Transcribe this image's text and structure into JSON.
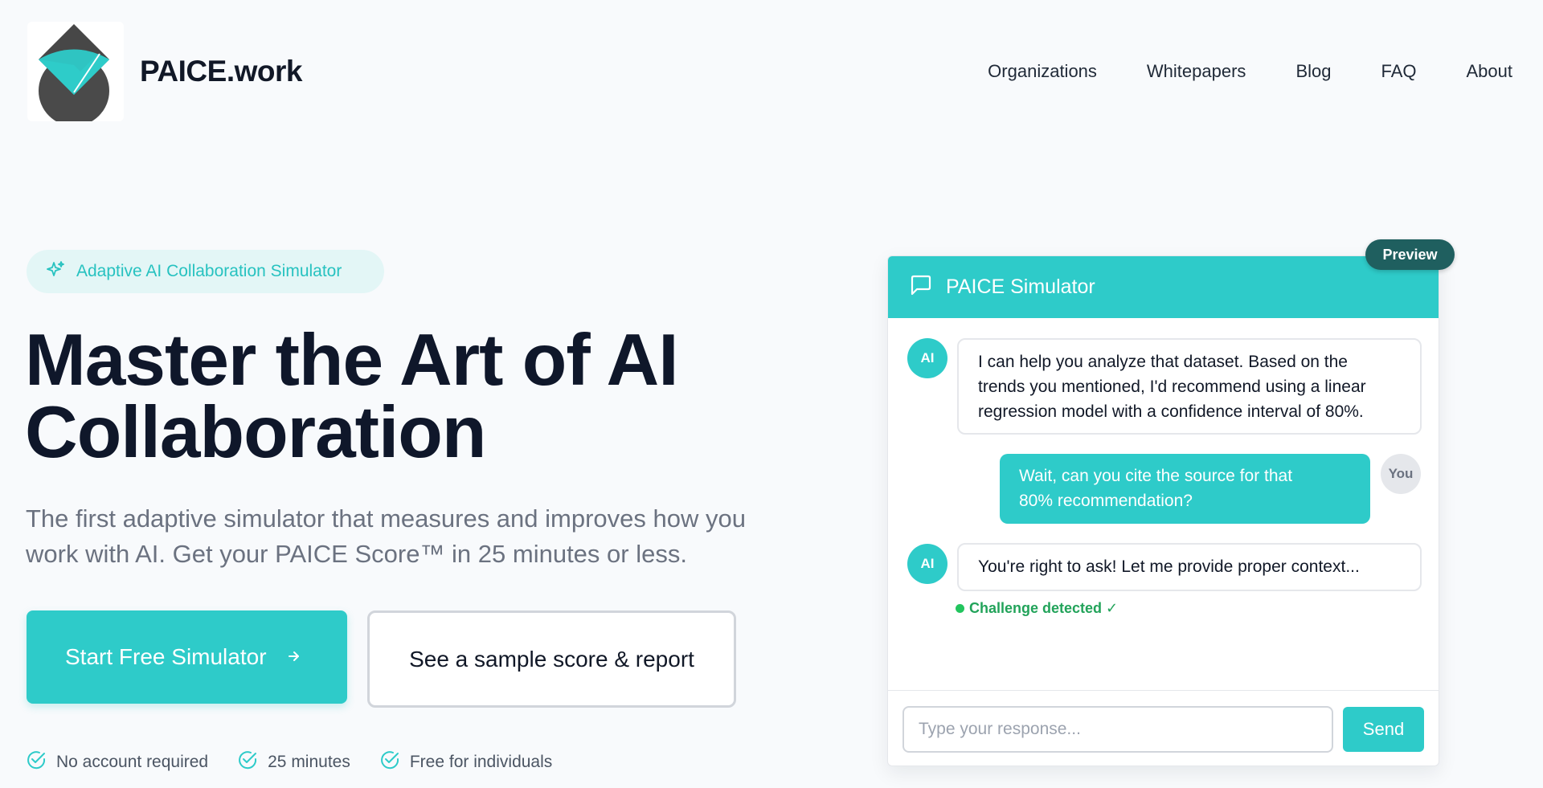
{
  "header": {
    "brand": "PAICE.work",
    "nav": [
      "Organizations",
      "Whitepapers",
      "Blog",
      "FAQ",
      "About"
    ]
  },
  "hero": {
    "badge": "Adaptive AI Collaboration Simulator",
    "headline_line1": "Master the Art of AI",
    "headline_line2": "Collaboration",
    "subtext_line1": "The first adaptive simulator that measures and improves how you",
    "subtext_line2": "work with AI. Get your PAICE Score™ in 25 minutes or less.",
    "primary_cta": "Start Free Simulator",
    "secondary_cta": "See a sample score & report",
    "perks": [
      "No account required",
      "25 minutes",
      "Free for individuals"
    ]
  },
  "simulator": {
    "title": "PAICE Simulator",
    "preview_badge": "Preview",
    "messages": [
      {
        "role": "AI",
        "lines": [
          "I can help you analyze that dataset. Based on the",
          "trends you mentioned, I'd recommend using a linear",
          "regression model with a confidence interval of 80%."
        ]
      },
      {
        "role": "You",
        "lines": [
          "Wait, can you cite the source for that",
          "80% recommendation?"
        ]
      },
      {
        "role": "AI",
        "lines": [
          "You're right to ask! Let me provide proper context..."
        ]
      }
    ],
    "status": "Challenge detected ✓",
    "input_placeholder": "Type your response...",
    "send_label": "Send"
  },
  "colors": {
    "accent": "#2ecbc9",
    "heading": "#0f172a",
    "preview_badge": "#1f5f5f",
    "success": "#22a35a",
    "background": "#f8fafc"
  },
  "icons": [
    "paice-logo",
    "sparkles-icon",
    "arrow-right-icon",
    "check-circle-icon",
    "chat-bubble-icon"
  ]
}
